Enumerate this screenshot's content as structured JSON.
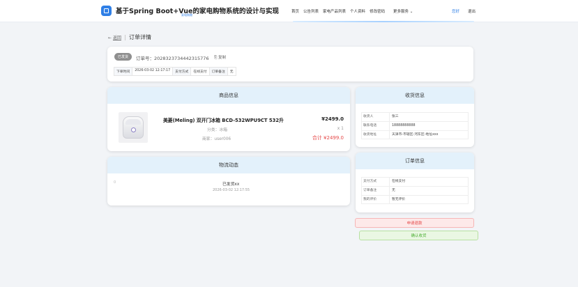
{
  "header": {
    "title": "基于Spring Boot+Vue的家电购物系统的设计与实现",
    "subtitle": "家电购物",
    "nav": [
      "首页",
      "公告列表",
      "家电产品列表",
      "个人资料",
      "修改密码"
    ],
    "more": "更多服务",
    "user": "您好",
    "logout": "退出"
  },
  "breadcrumb": {
    "back": "返回",
    "title": "订单详情"
  },
  "order": {
    "status": "已发货",
    "order_no_label": "订单号：",
    "order_no": "20283237344423157​76",
    "copy": "复制",
    "meta": [
      {
        "k": "下单时间",
        "v": "2026-03-02 12:17:17"
      },
      {
        "k": "支付方式",
        "v": "在线支付"
      },
      {
        "k": "订单备注",
        "v": "无"
      }
    ]
  },
  "goods": {
    "heading": "商品信息",
    "name": "美菱(Meling) 双开门冰箱 BCD-532WPU9CT 532升",
    "category": "分类：冰箱",
    "seller": "商家：user006",
    "price": "¥2499.0",
    "qty": "x 1",
    "total": "合计 ¥2499.0"
  },
  "logistics": {
    "heading": "物流动态",
    "dot": "0",
    "status": "已发货xx",
    "time": "2026-03-02 12:17:55"
  },
  "receiver": {
    "heading": "收货信息",
    "rows": [
      {
        "k": "收货人",
        "v": "张三"
      },
      {
        "k": "联系电话",
        "v": "18888888888"
      },
      {
        "k": "收货地址",
        "v": "天津市-市辖区-河东区-地址xxx"
      }
    ]
  },
  "order_info": {
    "heading": "订单信息",
    "rows": [
      {
        "k": "支付方式",
        "v": "在线支付"
      },
      {
        "k": "订单备注",
        "v": "无"
      },
      {
        "k": "我的评价",
        "v": "暂无评价"
      }
    ]
  },
  "actions": {
    "refund": "申请退款",
    "confirm": "确认收货"
  },
  "colors": {
    "accent": "#2f7fe6",
    "danger": "#e54848",
    "success": "#4caf34",
    "card_head": "#e3f1fb"
  }
}
